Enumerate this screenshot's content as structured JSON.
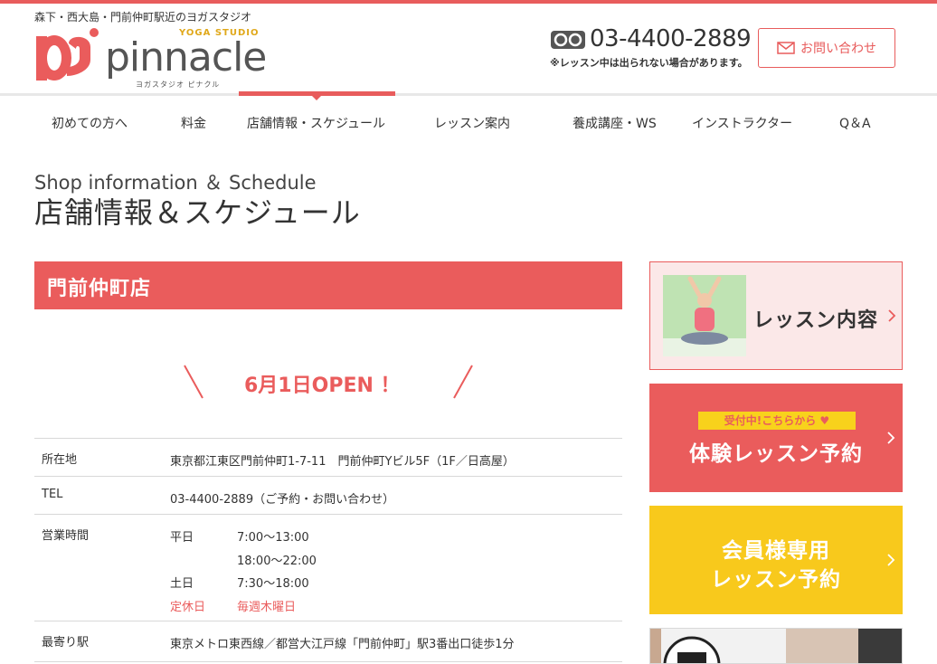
{
  "header": {
    "tagline": "森下・西大島・門前仲町駅近のヨガスタジオ",
    "logo": {
      "yoga_studio": "YOGA STUDIO",
      "wordmark": "pinnacle",
      "kana": "ヨガスタジオ ピナクル"
    },
    "phone": {
      "number": "03-4400-2889",
      "note": "※レッスン中は出られない場合があります。",
      "icon": "free-dial-icon"
    },
    "contact_button": {
      "label": "お問い合わせ",
      "icon": "mail-icon"
    }
  },
  "nav": {
    "items": [
      {
        "label": "初めての方へ"
      },
      {
        "label": "料金"
      },
      {
        "label": "店舗情報・スケジュール",
        "active": true
      },
      {
        "label": "レッスン案内"
      },
      {
        "label": "養成講座・WS"
      },
      {
        "label": "インストラクター"
      },
      {
        "label": "Q＆A"
      }
    ]
  },
  "page": {
    "title_en": "Shop information ＆ Schedule",
    "title_ja": "店舗情報＆スケジュール"
  },
  "shop": {
    "name": "門前仲町店",
    "open_announcement": "6月1日OPEN ！",
    "info": {
      "address_label": "所在地",
      "address": "東京都江東区門前仲町1-7-11　門前仲町Yビル5F（1F／日高屋）",
      "tel_label": "TEL",
      "tel": "03-4400-2889（ご予約・お問い合わせ）",
      "hours_label": "営業時間",
      "hours": [
        {
          "day": "平日",
          "time": "7:00〜13:00"
        },
        {
          "day": "",
          "time": "18:00〜22:00"
        },
        {
          "day": "土日",
          "time": "7:30〜18:00"
        },
        {
          "day": "定休日",
          "time": "毎週木曜日"
        }
      ],
      "station_label": "最寄り駅",
      "station": "東京メトロ東西線／都営大江戸線「門前仲町」駅3番出口徒歩1分"
    }
  },
  "sidebar": {
    "lesson_content": "レッスン内容",
    "trial_badge": "受付中!こちらから ♥",
    "trial_label": "体験レッスン予約",
    "member_line1": "会員様専用",
    "member_line2": "レッスン予約"
  },
  "colors": {
    "accent": "#ea5c5c",
    "yellow": "#f8c91c",
    "badge_yellow": "#f8d21c"
  }
}
